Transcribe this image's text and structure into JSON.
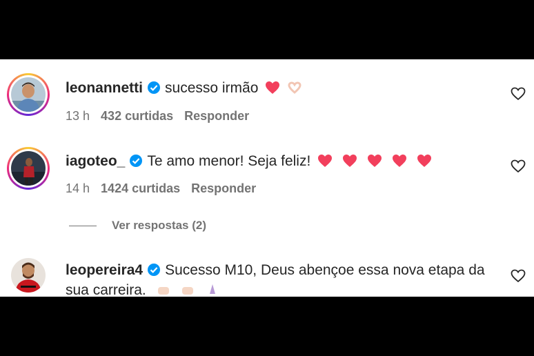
{
  "comments": [
    {
      "username": "leonannetti",
      "text": "sucesso irmão",
      "time": "13 h",
      "likes": "432 curtidas",
      "reply": "Responder"
    },
    {
      "username": "iagoteo_",
      "text": "Te amo menor! Seja feliz!",
      "time": "14 h",
      "likes": "1424 curtidas",
      "reply": "Responder",
      "view_replies": "Ver respostas (2)"
    },
    {
      "username": "leopereira4",
      "text_line1": "Sucesso M10, Deus abençoe essa nova etapa da",
      "text_line2": "sua carreira."
    }
  ],
  "colors": {
    "text": "#262626",
    "secondary": "#737373",
    "verified": "#0095f6",
    "heart_emoji": "#f23f5c"
  }
}
